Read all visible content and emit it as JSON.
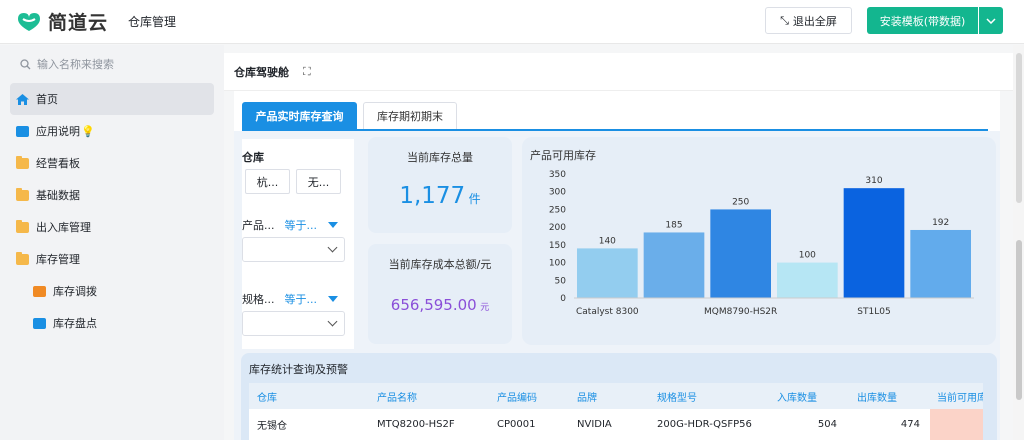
{
  "header": {
    "brand": "简道云",
    "app_name": "仓库管理",
    "exit_fullscreen": "退出全屏",
    "install_template": "安装模板(带数据)"
  },
  "sidebar": {
    "search_placeholder": "输入名称来搜索",
    "items": [
      {
        "label": "首页",
        "icon": "home-icon",
        "active": true
      },
      {
        "label": "应用说明",
        "icon": "doc-icon",
        "extra": "💡"
      },
      {
        "label": "经营看板",
        "icon": "folder-icon"
      },
      {
        "label": "基础数据",
        "icon": "folder-icon"
      },
      {
        "label": "出入库管理",
        "icon": "folder-icon"
      },
      {
        "label": "库存管理",
        "icon": "folder-open-icon"
      },
      {
        "label": "库存调拨",
        "icon": "chart-icon",
        "sub": true
      },
      {
        "label": "库存盘点",
        "icon": "doc-icon",
        "sub": true
      }
    ]
  },
  "page": {
    "title": "仓库驾驶舱",
    "tabs": [
      "产品实时库存查询",
      "库存期初期末"
    ]
  },
  "filters": {
    "warehouse_label": "仓库",
    "warehouse_buttons": [
      "杭...",
      "无..."
    ],
    "product_label": "产品...",
    "product_op": "等于...",
    "spec_label": "规格...",
    "spec_op": "等于..."
  },
  "kpis": {
    "total_stock_title": "当前库存总量",
    "total_stock_value": "1,177",
    "total_stock_unit": "件",
    "total_cost_title": "当前库存成本总额/元",
    "total_cost_value": "656,595.00",
    "total_cost_unit": "元"
  },
  "chart_data": {
    "type": "bar",
    "title": "产品可用库存",
    "categories": [
      "Catalyst 8300",
      "",
      "MQM8790-HS2R",
      "",
      "ST1L05",
      ""
    ],
    "values": [
      140,
      185,
      250,
      100,
      310,
      192
    ],
    "ylim": [
      0,
      350
    ],
    "yticks": [
      0,
      50,
      100,
      150,
      200,
      250,
      300,
      350
    ],
    "colors": [
      "#93cdef",
      "#6aaeea",
      "#2f86e3",
      "#b6e6f4",
      "#0a63e0",
      "#62abec"
    ],
    "grid": false,
    "xlabel": "",
    "ylabel": ""
  },
  "table": {
    "title": "库存统计查询及预警",
    "columns": [
      "仓库",
      "产品名称",
      "产品编码",
      "品牌",
      "规格型号",
      "入库数量",
      "出库数量",
      "当前可用库存"
    ],
    "rows": [
      [
        "无锡仓",
        "MTQ8200-HS2F",
        "CP0001",
        "NVIDIA",
        "200G-HDR-QSFP56",
        "504",
        "474",
        ""
      ]
    ]
  }
}
